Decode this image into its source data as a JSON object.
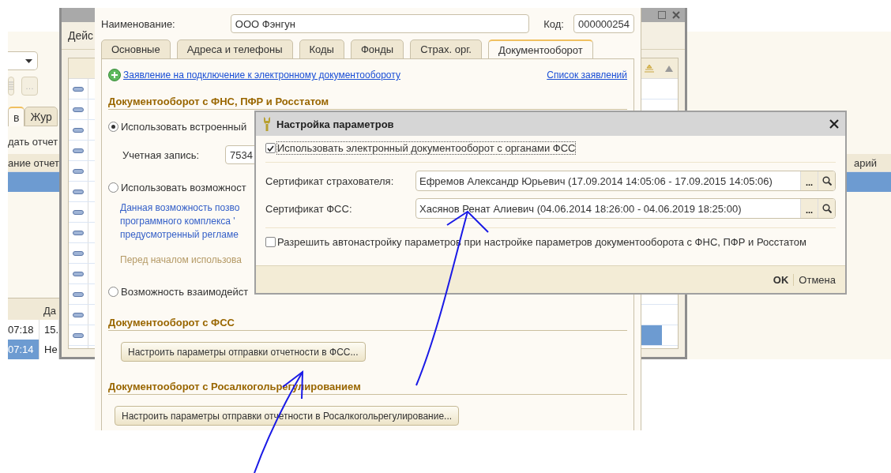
{
  "background_window": {
    "small_button": "…",
    "tabs": [
      {
        "label": "в",
        "selected": true
      },
      {
        "label": "Жур",
        "selected": false
      }
    ],
    "command": "дать отчет",
    "report_table": {
      "column": "ание отчет",
      "column_2": "арий",
      "rows": [
        {
          "selected": true
        }
      ]
    },
    "journal_table": {
      "column": "Да",
      "rows": [
        {
          "time": "07:18",
          "column_2": "15.",
          "selected": false
        },
        {
          "time": "07:14",
          "column_2": "Не",
          "selected": true
        }
      ]
    }
  },
  "list_window": {
    "menu": "Дейс",
    "current_row": {
      "selected": true
    }
  },
  "form": {
    "name_label": "Наименование:",
    "name_value": "ООО Фэнгун",
    "code_label": "Код:",
    "code_value": "000000254",
    "tabs": [
      {
        "label": "Основные",
        "selected": false
      },
      {
        "label": "Адреса и телефоны",
        "selected": false
      },
      {
        "label": "Коды",
        "selected": false
      },
      {
        "label": "Фонды",
        "selected": false
      },
      {
        "label": "Страх. орг.",
        "selected": false
      },
      {
        "label": "Документооборот",
        "selected": true
      }
    ],
    "link": "Заявление на подключение к электронному документообороту",
    "list_link": "Список заявлений",
    "sections": [
      {
        "heading": "Документооборот с ФНС, ПФР и Росстатом",
        "items": [
          {
            "kind": "radio",
            "label": "Использовать встроенный",
            "selected": true
          },
          {
            "kind": "field",
            "label": "Учетная запись:",
            "value": "7534"
          },
          {
            "kind": "radio",
            "label": "Использовать возможност",
            "selected": false
          },
          {
            "kind": "info",
            "lines": [
              "Данная возможность позво",
              "программного комплекса '",
              "предусмотренный регламе"
            ]
          },
          {
            "kind": "hint",
            "text": "Перед началом использова"
          },
          {
            "kind": "radio",
            "label": "Возможность взаимодейст",
            "selected": false
          }
        ]
      },
      {
        "heading": "Документооборот с ФСС",
        "items": [
          {
            "kind": "button",
            "label": "Настроить параметры отправки отчетности в ФСС..."
          }
        ]
      },
      {
        "heading": "Документооборот с Росалкогольрегулированием",
        "items": [
          {
            "kind": "button",
            "label": "Настроить параметры отправки отчетности в Росалкогольрегулирование..."
          }
        ]
      }
    ]
  },
  "dialog": {
    "title": "Настройка параметров",
    "use_edo": {
      "label": "Использовать электронный документооборот с органами ФСС",
      "checked": true
    },
    "fields": [
      {
        "label": "Сертификат страхователя:",
        "value": "Ефремов Александр Юрьевич (17.09.2014 14:05:06 - 17.09.2015 14:05:06)",
        "pick": "..."
      },
      {
        "label": "Сертификат ФСС:",
        "value": "Хасянов Ренат Алиевич (04.06.2014 18:26:00 - 04.06.2019 18:25:00)",
        "pick": "..."
      }
    ],
    "auto_setup": {
      "label": "Разрешить автонастройку параметров при настройке параметров документооборота с ФНС, ПФР и Росстатом",
      "checked": false
    },
    "buttons": [
      {
        "label": "OK",
        "default": true
      },
      {
        "label": "Отмена",
        "default": false
      }
    ]
  }
}
